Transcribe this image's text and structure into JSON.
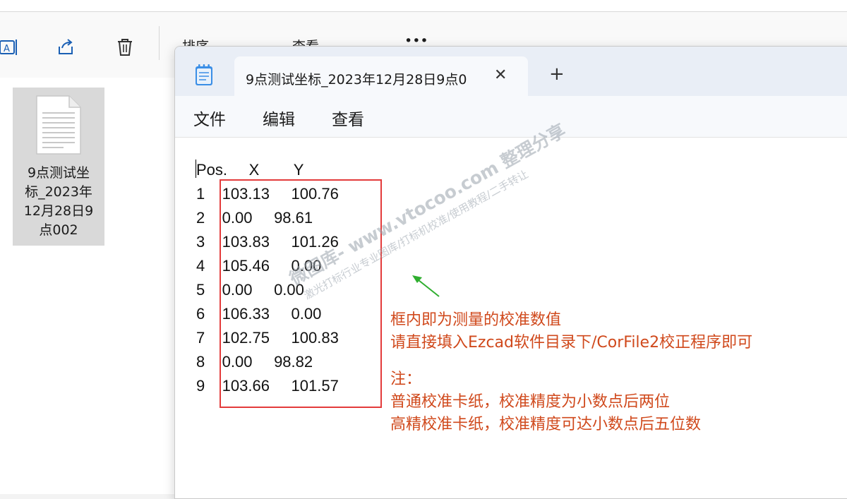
{
  "explorer": {
    "toolbar": {
      "sort_label": "排序",
      "view_label": "查看",
      "more_label": "•••"
    },
    "file": {
      "name_lines": [
        "9点测试坐",
        "标_2023年",
        "12月28日9",
        "点002"
      ]
    }
  },
  "notepad": {
    "tab_title": "9点测试坐标_2023年12月28日9点0",
    "tab_close": "✕",
    "tab_add": "+",
    "menu": [
      "文件",
      "编辑",
      "查看"
    ],
    "content_lines": [
      "Pos.     X        Y",
      "1    103.13     100.76",
      "2    0.00     98.61",
      "3    103.83     101.26",
      "4    105.46     0.00",
      "5    0.00     0.00",
      "6    106.33     0.00",
      "7    102.75     100.83",
      "8    0.00     98.82",
      "9    103.66     101.57"
    ]
  },
  "annotation": {
    "lines": [
      "框内即为测量的校准数值",
      "请直接填入Ezcad软件目录下/CorFile2校正程序即可",
      "",
      "注：",
      "普通校准卡纸，校准精度为小数点后两位",
      "高精校准卡纸，校准精度可达小数点后五位数"
    ],
    "color": "#d0491c",
    "box_color": "#e33b3b",
    "arrow_color": "#2fae2f"
  },
  "watermark": {
    "line1": "微图库- www.vtocoo.com 整理分享",
    "line2": "激光打标行业专业图库/打标机校准/使用教程/二手转让"
  }
}
